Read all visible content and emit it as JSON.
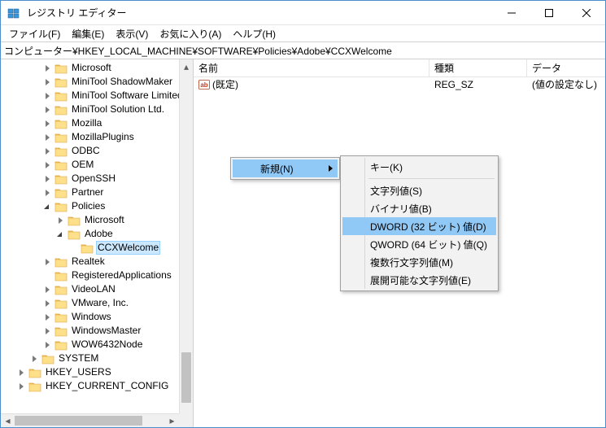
{
  "window": {
    "title": "レジストリ エディター"
  },
  "menu": {
    "file": "ファイル(F)",
    "edit": "編集(E)",
    "view": "表示(V)",
    "fav": "お気に入り(A)",
    "help": "ヘルプ(H)"
  },
  "address": "コンピューター¥HKEY_LOCAL_MACHINE¥SOFTWARE¥Policies¥Adobe¥CCXWelcome",
  "tree": {
    "items": [
      "Microsoft",
      "MiniTool ShadowMaker",
      "MiniTool Software Limited",
      "MiniTool Solution Ltd.",
      "Mozilla",
      "MozillaPlugins",
      "ODBC",
      "OEM",
      "OpenSSH",
      "Partner",
      "Policies",
      "Microsoft",
      "Adobe",
      "CCXWelcome",
      "Realtek",
      "RegisteredApplications",
      "VideoLAN",
      "VMware, Inc.",
      "Windows",
      "WindowsMaster",
      "WOW6432Node",
      "SYSTEM",
      "HKEY_USERS",
      "HKEY_CURRENT_CONFIG"
    ]
  },
  "columns": {
    "name": "名前",
    "type": "種類",
    "data": "データ"
  },
  "values": {
    "default_name": "(既定)",
    "default_type": "REG_SZ",
    "default_data": "(値の設定なし)"
  },
  "context": {
    "new": "新規(N)",
    "submenu": {
      "key": "キー(K)",
      "string": "文字列値(S)",
      "binary": "バイナリ値(B)",
      "dword": "DWORD (32 ビット) 値(D)",
      "qword": "QWORD (64 ビット) 値(Q)",
      "multi": "複数行文字列値(M)",
      "expand": "展開可能な文字列値(E)"
    }
  }
}
